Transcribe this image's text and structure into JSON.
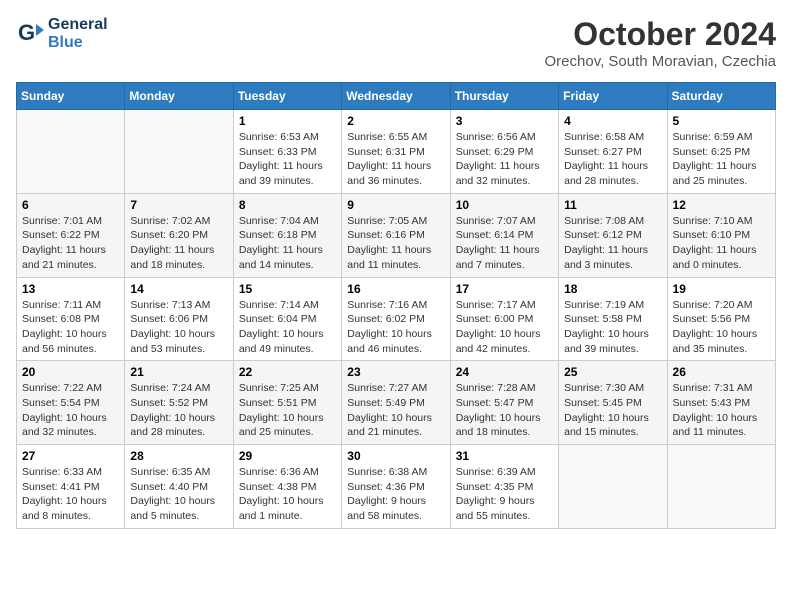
{
  "header": {
    "logo_line1": "General",
    "logo_line2": "Blue",
    "month": "October 2024",
    "location": "Orechov, South Moravian, Czechia"
  },
  "weekdays": [
    "Sunday",
    "Monday",
    "Tuesday",
    "Wednesday",
    "Thursday",
    "Friday",
    "Saturday"
  ],
  "weeks": [
    [
      {
        "day": "",
        "info": ""
      },
      {
        "day": "",
        "info": ""
      },
      {
        "day": "1",
        "info": "Sunrise: 6:53 AM\nSunset: 6:33 PM\nDaylight: 11 hours and 39 minutes."
      },
      {
        "day": "2",
        "info": "Sunrise: 6:55 AM\nSunset: 6:31 PM\nDaylight: 11 hours and 36 minutes."
      },
      {
        "day": "3",
        "info": "Sunrise: 6:56 AM\nSunset: 6:29 PM\nDaylight: 11 hours and 32 minutes."
      },
      {
        "day": "4",
        "info": "Sunrise: 6:58 AM\nSunset: 6:27 PM\nDaylight: 11 hours and 28 minutes."
      },
      {
        "day": "5",
        "info": "Sunrise: 6:59 AM\nSunset: 6:25 PM\nDaylight: 11 hours and 25 minutes."
      }
    ],
    [
      {
        "day": "6",
        "info": "Sunrise: 7:01 AM\nSunset: 6:22 PM\nDaylight: 11 hours and 21 minutes."
      },
      {
        "day": "7",
        "info": "Sunrise: 7:02 AM\nSunset: 6:20 PM\nDaylight: 11 hours and 18 minutes."
      },
      {
        "day": "8",
        "info": "Sunrise: 7:04 AM\nSunset: 6:18 PM\nDaylight: 11 hours and 14 minutes."
      },
      {
        "day": "9",
        "info": "Sunrise: 7:05 AM\nSunset: 6:16 PM\nDaylight: 11 hours and 11 minutes."
      },
      {
        "day": "10",
        "info": "Sunrise: 7:07 AM\nSunset: 6:14 PM\nDaylight: 11 hours and 7 minutes."
      },
      {
        "day": "11",
        "info": "Sunrise: 7:08 AM\nSunset: 6:12 PM\nDaylight: 11 hours and 3 minutes."
      },
      {
        "day": "12",
        "info": "Sunrise: 7:10 AM\nSunset: 6:10 PM\nDaylight: 11 hours and 0 minutes."
      }
    ],
    [
      {
        "day": "13",
        "info": "Sunrise: 7:11 AM\nSunset: 6:08 PM\nDaylight: 10 hours and 56 minutes."
      },
      {
        "day": "14",
        "info": "Sunrise: 7:13 AM\nSunset: 6:06 PM\nDaylight: 10 hours and 53 minutes."
      },
      {
        "day": "15",
        "info": "Sunrise: 7:14 AM\nSunset: 6:04 PM\nDaylight: 10 hours and 49 minutes."
      },
      {
        "day": "16",
        "info": "Sunrise: 7:16 AM\nSunset: 6:02 PM\nDaylight: 10 hours and 46 minutes."
      },
      {
        "day": "17",
        "info": "Sunrise: 7:17 AM\nSunset: 6:00 PM\nDaylight: 10 hours and 42 minutes."
      },
      {
        "day": "18",
        "info": "Sunrise: 7:19 AM\nSunset: 5:58 PM\nDaylight: 10 hours and 39 minutes."
      },
      {
        "day": "19",
        "info": "Sunrise: 7:20 AM\nSunset: 5:56 PM\nDaylight: 10 hours and 35 minutes."
      }
    ],
    [
      {
        "day": "20",
        "info": "Sunrise: 7:22 AM\nSunset: 5:54 PM\nDaylight: 10 hours and 32 minutes."
      },
      {
        "day": "21",
        "info": "Sunrise: 7:24 AM\nSunset: 5:52 PM\nDaylight: 10 hours and 28 minutes."
      },
      {
        "day": "22",
        "info": "Sunrise: 7:25 AM\nSunset: 5:51 PM\nDaylight: 10 hours and 25 minutes."
      },
      {
        "day": "23",
        "info": "Sunrise: 7:27 AM\nSunset: 5:49 PM\nDaylight: 10 hours and 21 minutes."
      },
      {
        "day": "24",
        "info": "Sunrise: 7:28 AM\nSunset: 5:47 PM\nDaylight: 10 hours and 18 minutes."
      },
      {
        "day": "25",
        "info": "Sunrise: 7:30 AM\nSunset: 5:45 PM\nDaylight: 10 hours and 15 minutes."
      },
      {
        "day": "26",
        "info": "Sunrise: 7:31 AM\nSunset: 5:43 PM\nDaylight: 10 hours and 11 minutes."
      }
    ],
    [
      {
        "day": "27",
        "info": "Sunrise: 6:33 AM\nSunset: 4:41 PM\nDaylight: 10 hours and 8 minutes."
      },
      {
        "day": "28",
        "info": "Sunrise: 6:35 AM\nSunset: 4:40 PM\nDaylight: 10 hours and 5 minutes."
      },
      {
        "day": "29",
        "info": "Sunrise: 6:36 AM\nSunset: 4:38 PM\nDaylight: 10 hours and 1 minute."
      },
      {
        "day": "30",
        "info": "Sunrise: 6:38 AM\nSunset: 4:36 PM\nDaylight: 9 hours and 58 minutes."
      },
      {
        "day": "31",
        "info": "Sunrise: 6:39 AM\nSunset: 4:35 PM\nDaylight: 9 hours and 55 minutes."
      },
      {
        "day": "",
        "info": ""
      },
      {
        "day": "",
        "info": ""
      }
    ]
  ]
}
